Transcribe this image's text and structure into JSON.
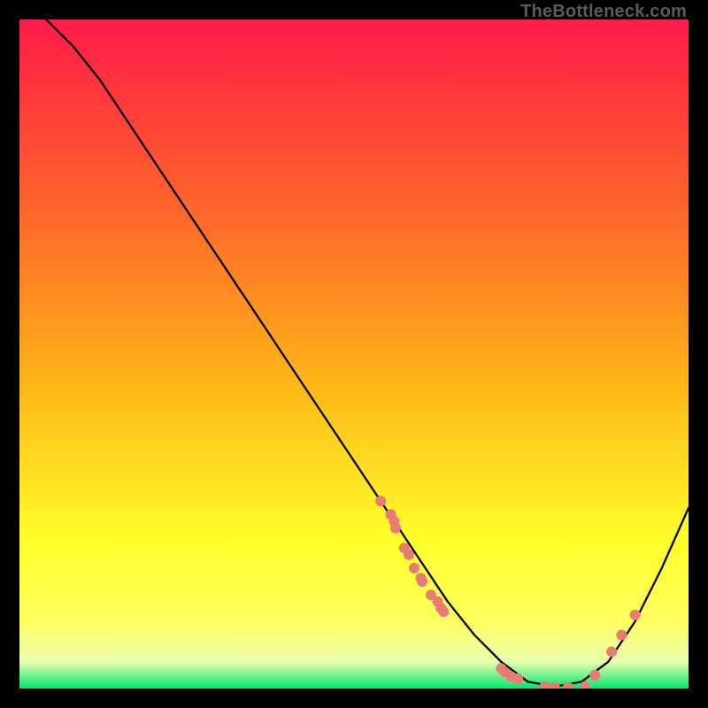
{
  "watermark": "TheBottleneck.com",
  "chart_data": {
    "type": "line",
    "title": "",
    "xlabel": "",
    "ylabel": "",
    "xlim": [
      0,
      100
    ],
    "ylim": [
      0,
      100
    ],
    "curve": {
      "name": "bottleneck-curve",
      "x": [
        4,
        8,
        12,
        16,
        20,
        24,
        28,
        32,
        36,
        40,
        44,
        48,
        52,
        56,
        60,
        64,
        68,
        72,
        76,
        80,
        84,
        88,
        92,
        96,
        100
      ],
      "y": [
        100,
        96,
        91,
        85,
        79,
        73,
        67,
        61,
        55,
        49,
        43,
        37,
        31,
        25,
        19,
        13,
        8,
        4,
        1,
        0.3,
        1,
        4,
        10,
        18,
        27
      ]
    },
    "points": {
      "name": "sample-dots",
      "color": "#e97a74",
      "x": [
        54,
        55.5,
        56,
        56.2,
        57.5,
        58.2,
        59,
        60,
        60.2,
        61.5,
        62.5,
        63,
        63.4,
        72,
        72.5,
        73.5,
        74.5,
        78.5,
        80,
        82,
        84.5,
        86,
        88.5,
        90,
        92
      ],
      "y": [
        28,
        26,
        25,
        24,
        21,
        20,
        18,
        16.5,
        16,
        14,
        13,
        12,
        11.5,
        3,
        2.5,
        1.8,
        1.5,
        0.3,
        0.2,
        0.2,
        0.3,
        2,
        5.5,
        8,
        11
      ]
    }
  }
}
